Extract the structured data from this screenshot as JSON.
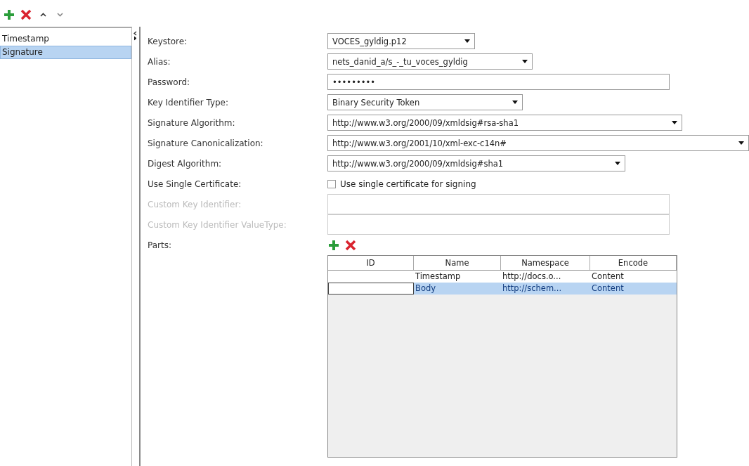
{
  "toolbar": {
    "buttons": [
      {
        "kind": "add"
      },
      {
        "kind": "remove"
      },
      {
        "kind": "up"
      },
      {
        "kind": "down"
      }
    ]
  },
  "sidebar": {
    "items": [
      {
        "label": "Timestamp",
        "selected": false
      },
      {
        "label": "Signature",
        "selected": true
      }
    ]
  },
  "form": {
    "fields": [
      {
        "kind": "select",
        "label": "Keystore:",
        "value": "VOCES_gyldig.p12",
        "disabled": false
      },
      {
        "kind": "select",
        "label": "Alias:",
        "value": "nets_danid_a/s_-_tu_voces_gyldig",
        "disabled": false
      },
      {
        "kind": "text",
        "label": "Password:",
        "value": "•••••••••",
        "disabled": false
      },
      {
        "kind": "select",
        "label": "Key Identifier Type:",
        "value": "Binary Security Token",
        "disabled": false
      },
      {
        "kind": "select",
        "label": "Signature Algorithm:",
        "value": "http://www.w3.org/2000/09/xmldsig#rsa-sha1",
        "disabled": false
      },
      {
        "kind": "select",
        "label": "Signature Canonicalization:",
        "value": "http://www.w3.org/2001/10/xml-exc-c14n#",
        "disabled": false
      },
      {
        "kind": "select",
        "label": "Digest Algorithm:",
        "value": "http://www.w3.org/2000/09/xmldsig#sha1",
        "disabled": false
      },
      {
        "kind": "checkbox",
        "label": "Use Single Certificate:",
        "value": "Use single certificate for signing",
        "checked": false,
        "disabled": false
      },
      {
        "kind": "text",
        "label": "Custom Key Identifier:",
        "disabled": true
      },
      {
        "kind": "text",
        "label": "Custom Key Identifier ValueType:",
        "disabled": true
      }
    ]
  },
  "parts": {
    "label": "Parts:",
    "table": {
      "columns": [
        "ID",
        "Name",
        "Namespace",
        "Encode"
      ],
      "rows": [
        {
          "cells": [
            "",
            "Timestamp",
            "http://docs.o...",
            "Content"
          ],
          "selected": false
        },
        {
          "cells": [
            "",
            "Body",
            "http://schem...",
            "Content"
          ],
          "selected": true
        }
      ]
    }
  }
}
